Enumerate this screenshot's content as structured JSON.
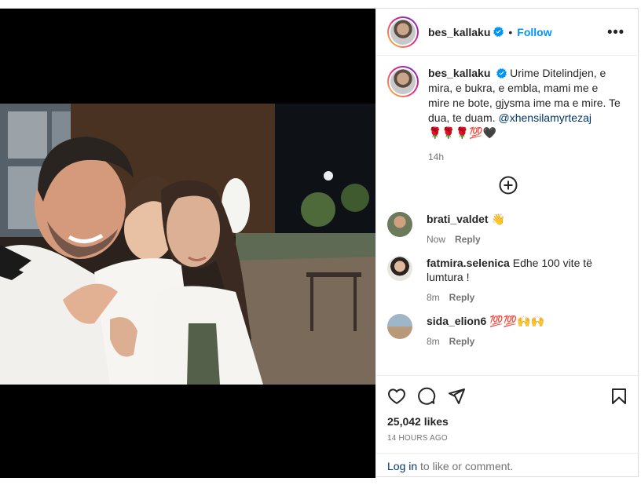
{
  "post": {
    "username": "bes_kallaku",
    "follow_label": "Follow",
    "dot": "•",
    "more_label": "•••"
  },
  "caption": {
    "username": "bes_kallaku",
    "text": "Urime Ditelindjen, e mira, e bukra, e embla, mami me e mire ne bote, gjysma ime ma e mire. Te dua, te duam.",
    "mention": "@xhensilamyrtezaj",
    "emoji": "🌹🌹🌹💯🖤",
    "time": "14h"
  },
  "comments": [
    {
      "username": "brati_valdet",
      "text": "👋",
      "time": "Now",
      "reply_label": "Reply"
    },
    {
      "username": "fatmira.selenica",
      "text": "Edhe 100 vite të lumtura !",
      "time": "8m",
      "reply_label": "Reply"
    },
    {
      "username": "sida_elion6",
      "text": "💯💯🙌🙌",
      "time": "8m",
      "reply_label": "Reply"
    }
  ],
  "icons": {
    "like": "heart-icon",
    "comment": "comment-icon",
    "share": "share-icon",
    "save": "bookmark-icon",
    "add": "plus-circle-icon",
    "verified": "verified-badge-icon"
  },
  "stats": {
    "likes": "25,042 likes",
    "posted": "14 HOURS AGO"
  },
  "login": {
    "link": "Log in",
    "rest": " to like or comment."
  },
  "colors": {
    "accent": "#0095f6",
    "mention": "#00376b",
    "muted": "#737373",
    "border": "#dbdbdb"
  }
}
